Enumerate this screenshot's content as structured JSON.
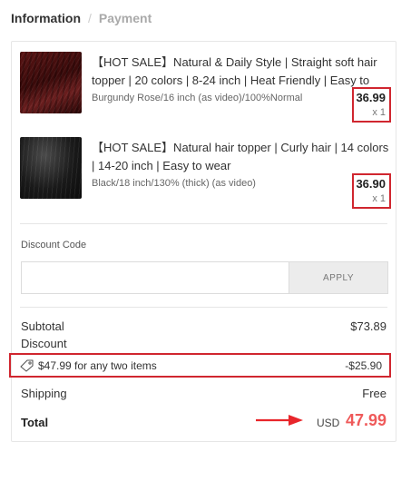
{
  "breadcrumb": {
    "information": "Information",
    "separator": "/",
    "payment": "Payment"
  },
  "items": [
    {
      "title": "【HOT SALE】Natural & Daily Style | Straight soft hair topper | 20 colors | 8-24 inch | Heat Friendly | Easy to We...",
      "variant": "Burgundy Rose/16 inch (as video)/100%Normal",
      "price": "36.99",
      "qty": "x 1",
      "thumb_color": "#4a1010"
    },
    {
      "title": "【HOT SALE】Natural hair topper | Curly hair | 14 colors | 14-20 inch | Easy to wear",
      "variant": "Black/18 inch/130%  (thick)  (as video)",
      "price": "36.90",
      "qty": "x 1",
      "thumb_color": "#1a1a1a"
    }
  ],
  "discount_code": {
    "label": "Discount Code",
    "value": "",
    "placeholder": "",
    "apply_label": "APPLY"
  },
  "summary": {
    "subtotal_label": "Subtotal",
    "subtotal_value": "$73.89",
    "discount_label": "Discount",
    "promo_text": "$47.99 for any two items",
    "promo_amount": "-$25.90",
    "shipping_label": "Shipping",
    "shipping_value": "Free",
    "total_label": "Total",
    "total_currency": "USD",
    "total_amount": "47.99"
  },
  "colors": {
    "highlight_border": "#d0262f",
    "total_amount": "#ef5a5a",
    "arrow": "#e8262b"
  }
}
